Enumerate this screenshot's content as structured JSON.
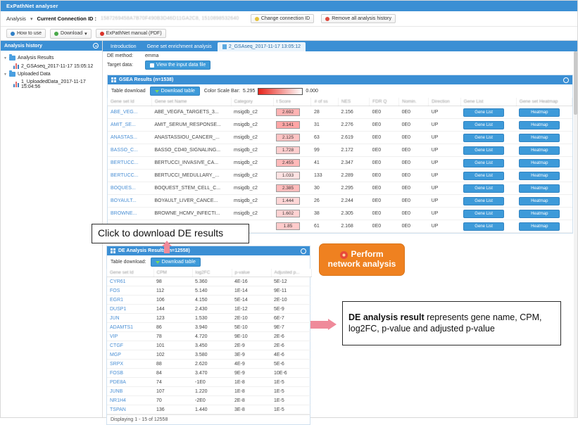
{
  "app": {
    "title": "ExPathNet analyser",
    "analysis_menu": "Analysis",
    "connection_label": "Current Connection ID :",
    "connection_id": "1587269458A7B70F490B3D46D11GA2C8, 1510898532640",
    "change_connection_btn": "Change connection ID",
    "remove_history_btn": "Remove all analysis history",
    "how_to_use_btn": "How to use",
    "download_btn": "Download",
    "manual_btn": "ExPathNet manual (PDF)"
  },
  "sidebar": {
    "title": "Analysis history",
    "nodes": [
      {
        "label": "Analysis Results",
        "type": "folder"
      },
      {
        "label": "2_GSAseq_2017-11-17 15:05:12",
        "type": "result"
      },
      {
        "label": "Uploaded Data",
        "type": "folder"
      },
      {
        "label": "1_UploadedData_2017-11-17 15:04:56",
        "type": "result"
      }
    ]
  },
  "tabs": [
    {
      "label": "Introduction",
      "active": false
    },
    {
      "label": "Gene set enrichment analysis",
      "active": false
    },
    {
      "label": "2_GSAseq_2017-11-17 13:05:12",
      "active": true
    }
  ],
  "meta": {
    "de_method_label": "DE method:",
    "de_method_value": "emma",
    "target_data_label": "Target data:",
    "view_input_btn": "View the input data file"
  },
  "gsea": {
    "panel_title": "GSEA Results (n=1538)",
    "table_download_label": "Table download",
    "download_table_btn": "Download table",
    "color_scale_label": "Color Scale Bar:",
    "color_scale_max": "5.295",
    "color_scale_min": "0.000",
    "columns": [
      "Gene set Id",
      "Gene set Name",
      "Category",
      "t Score",
      "# of ss",
      "NES",
      "FDR Q",
      "Nomin.",
      "Direction",
      "Gene List",
      "Gene set Heatmap"
    ],
    "gene_list_btn": "Gene List",
    "heatmap_btn": "Heatmap",
    "rows": [
      {
        "id": "ABE_VEG...",
        "name": "ABE_VEGFA_TARGETS_3...",
        "category": "msigdb_c2",
        "tscore": "2.692",
        "n": "28",
        "nes": "2.156",
        "fdr": "0E0",
        "nominal": "0E0",
        "direction": "UP"
      },
      {
        "id": "AMIT_SE...",
        "name": "AMIT_SERUM_RESPONSE...",
        "category": "msigdb_c2",
        "tscore": "3.141",
        "n": "31",
        "nes": "2.276",
        "fdr": "0E0",
        "nominal": "0E0",
        "direction": "UP"
      },
      {
        "id": "ANASTAS...",
        "name": "ANASTASSIOU_CANCER_...",
        "category": "msigdb_c2",
        "tscore": "2.125",
        "n": "63",
        "nes": "2.619",
        "fdr": "0E0",
        "nominal": "0E0",
        "direction": "UP"
      },
      {
        "id": "BASSO_C...",
        "name": "BASSO_CD40_SIGNALING...",
        "category": "msigdb_c2",
        "tscore": "1.728",
        "n": "99",
        "nes": "2.172",
        "fdr": "0E0",
        "nominal": "0E0",
        "direction": "UP"
      },
      {
        "id": "BERTUCC...",
        "name": "BERTUCCI_INVASIVE_CA...",
        "category": "msigdb_c2",
        "tscore": "2.455",
        "n": "41",
        "nes": "2.347",
        "fdr": "0E0",
        "nominal": "0E0",
        "direction": "UP"
      },
      {
        "id": "BERTUCC...",
        "name": "BERTUCCI_MEDULLARY_...",
        "category": "msigdb_c2",
        "tscore": "1.033",
        "n": "133",
        "nes": "2.289",
        "fdr": "0E0",
        "nominal": "0E0",
        "direction": "UP"
      },
      {
        "id": "BOQUES...",
        "name": "BOQUEST_STEM_CELL_C...",
        "category": "msigdb_c2",
        "tscore": "2.385",
        "n": "30",
        "nes": "2.295",
        "fdr": "0E0",
        "nominal": "0E0",
        "direction": "UP"
      },
      {
        "id": "BOYAULT...",
        "name": "BOYAULT_LIVER_CANCE...",
        "category": "msigdb_c2",
        "tscore": "1.444",
        "n": "26",
        "nes": "2.244",
        "fdr": "0E0",
        "nominal": "0E0",
        "direction": "UP"
      },
      {
        "id": "BROWNE...",
        "name": "BROWNE_HCMV_INFECTI...",
        "category": "msigdb_c2",
        "tscore": "1.602",
        "n": "38",
        "nes": "2.305",
        "fdr": "0E0",
        "nominal": "0E0",
        "direction": "UP"
      },
      {
        "id": "",
        "name": "",
        "category": "",
        "tscore": "1.85",
        "n": "61",
        "nes": "2.168",
        "fdr": "0E0",
        "nominal": "0E0",
        "direction": "UP"
      }
    ]
  },
  "de": {
    "panel_title": "DE Analysis Results (n=12558)",
    "table_download_label": "Table download:",
    "download_table_btn": "Download table",
    "columns": [
      "Gene set Id",
      "CPM",
      "log2FC",
      "p-value",
      "Adjusted p..."
    ],
    "footer": "Displaying 1 - 15 of 12558",
    "rows": [
      {
        "gene": "CYR61",
        "cpm": "98",
        "log2fc": "5.360",
        "pvalue": "4E-16",
        "adj": "5E-12"
      },
      {
        "gene": "FOS",
        "cpm": "112",
        "log2fc": "5.140",
        "pvalue": "1E-14",
        "adj": "9E-11"
      },
      {
        "gene": "EGR1",
        "cpm": "106",
        "log2fc": "4.150",
        "pvalue": "5E-14",
        "adj": "2E-10"
      },
      {
        "gene": "DUSP1",
        "cpm": "144",
        "log2fc": "2.430",
        "pvalue": "1E-12",
        "adj": "5E-9"
      },
      {
        "gene": "JUN",
        "cpm": "123",
        "log2fc": "1.530",
        "pvalue": "2E-10",
        "adj": "6E-7"
      },
      {
        "gene": "ADAMTS1",
        "cpm": "86",
        "log2fc": "3.940",
        "pvalue": "5E-10",
        "adj": "9E-7"
      },
      {
        "gene": "VIP",
        "cpm": "78",
        "log2fc": "4.720",
        "pvalue": "9E-10",
        "adj": "2E-6"
      },
      {
        "gene": "CTGF",
        "cpm": "101",
        "log2fc": "3.450",
        "pvalue": "2E-9",
        "adj": "2E-6"
      },
      {
        "gene": "MGP",
        "cpm": "102",
        "log2fc": "3.580",
        "pvalue": "3E-9",
        "adj": "4E-6"
      },
      {
        "gene": "SRPX",
        "cpm": "88",
        "log2fc": "2.620",
        "pvalue": "4E-9",
        "adj": "5E-6"
      },
      {
        "gene": "FOSB",
        "cpm": "84",
        "log2fc": "3.470",
        "pvalue": "9E-9",
        "adj": "10E-6"
      },
      {
        "gene": "PDE8A",
        "cpm": "74",
        "log2fc": "-1E0",
        "pvalue": "1E-8",
        "adj": "1E-5"
      },
      {
        "gene": "JUNB",
        "cpm": "107",
        "log2fc": "1.220",
        "pvalue": "1E-8",
        "adj": "1E-5"
      },
      {
        "gene": "NR1H4",
        "cpm": "70",
        "log2fc": "-2E0",
        "pvalue": "2E-8",
        "adj": "1E-5"
      },
      {
        "gene": "TSPAN",
        "cpm": "136",
        "log2fc": "1.440",
        "pvalue": "3E-8",
        "adj": "1E-5"
      }
    ]
  },
  "annotations": {
    "callout_download": "Click to download DE results",
    "perform_network_line1": "Perform",
    "perform_network_line2": "network analysis",
    "callout_de_bold": "DE analysis result",
    "callout_de_rest": " represents gene name, CPM, log2FC, p-value and adjusted p-value"
  },
  "colors": {
    "accent_blue": "#3b8fd4",
    "orange": "#ef8120",
    "pink_arrow": "#ef8a9a",
    "scale_red": "#e8231a"
  }
}
